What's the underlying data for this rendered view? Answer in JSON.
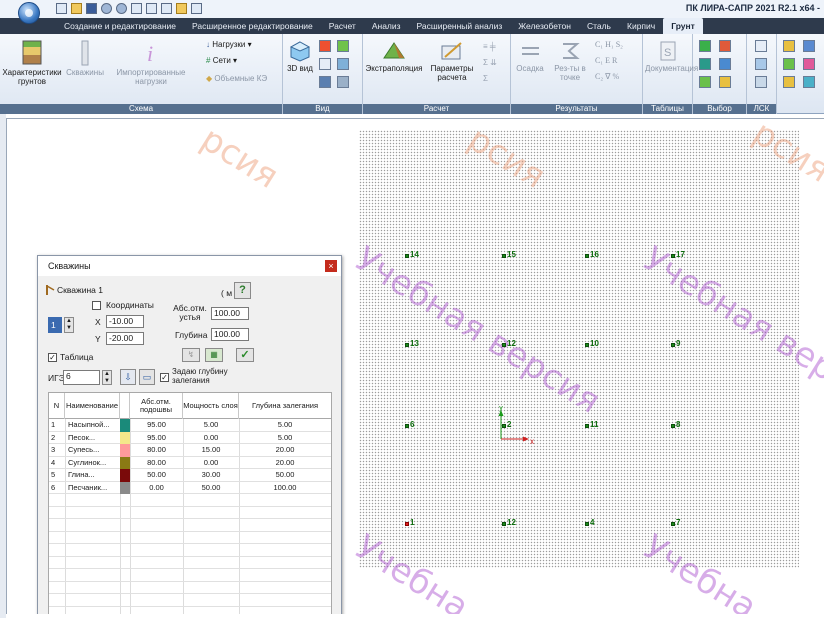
{
  "app": {
    "title": "ПК ЛИРА-САПР  2021 R2.1 x64 - "
  },
  "tabs": [
    {
      "label": "Создание и редактирование",
      "active": false
    },
    {
      "label": "Расширенное редактирование",
      "active": false
    },
    {
      "label": "Расчет",
      "active": false
    },
    {
      "label": "Анализ",
      "active": false
    },
    {
      "label": "Расширенный анализ",
      "active": false
    },
    {
      "label": "Железобетон",
      "active": false
    },
    {
      "label": "Сталь",
      "active": false
    },
    {
      "label": "Кирпич",
      "active": false
    },
    {
      "label": "Грунт",
      "active": true
    }
  ],
  "ribbon": {
    "groups": {
      "schema": "Схема",
      "view": "Вид",
      "calc": "Расчет",
      "results": "Результаты",
      "tables": "Таблицы",
      "selection": "Выбор",
      "lsk": "ЛСК"
    },
    "buttons": {
      "soil_chars": "Характеристики грунтов",
      "boreholes": "Скважины",
      "imported_loads": "Импортированные нагрузки",
      "loads": "Нагрузки",
      "meshes": "Сети",
      "volumetric_ke": "Объемные КЭ",
      "view3d": "3D вид",
      "extrapolation": "Экстраполяция",
      "calc_params": "Параметры расчета",
      "settlement": "Осадка",
      "results_at_point": "Рез-ты в точке",
      "documentation": "Документация"
    },
    "result_symbols": [
      "C₁",
      "H₁",
      "S₂",
      "C₁",
      "E",
      "R",
      "C₂",
      "∇",
      "%"
    ]
  },
  "dialog": {
    "title": "Скважины",
    "borehole_name": "Скважина 1",
    "units": "( м )",
    "help": "?",
    "borehole_number": "1",
    "coords_label": "Координаты",
    "x_label": "X",
    "x_value": "-10.00",
    "y_label": "Y",
    "y_value": "-20.00",
    "abs_mark_label": "Абс.отм. устья",
    "abs_mark_value": "100.00",
    "depth_label": "Глубина",
    "depth_value": "100.00",
    "table_checkbox": "Таблица",
    "table_checked": true,
    "ige_label": "ИГЭ",
    "ige_value": "6",
    "set_depth_label": "Задаю глубину залегания",
    "set_depth_checked": true,
    "columns": [
      "N",
      "Наименование",
      "",
      "Абс.отм. подошвы",
      "Мощность слоя",
      "Глубина залегания"
    ],
    "layers": [
      {
        "n": "1",
        "name": "Насыпной...",
        "color": "#1a8a7a",
        "abs": "95.00",
        "thickness": "5.00",
        "depth": "5.00"
      },
      {
        "n": "2",
        "name": "Песок...",
        "color": "#f4e88a",
        "abs": "95.00",
        "thickness": "0.00",
        "depth": "5.00"
      },
      {
        "n": "3",
        "name": "Супесь...",
        "color": "#ff9a9a",
        "abs": "80.00",
        "thickness": "15.00",
        "depth": "20.00"
      },
      {
        "n": "4",
        "name": "Суглинок...",
        "color": "#8a7a14",
        "abs": "80.00",
        "thickness": "0.00",
        "depth": "20.00"
      },
      {
        "n": "5",
        "name": "Глина...",
        "color": "#7a0a0a",
        "abs": "50.00",
        "thickness": "30.00",
        "depth": "50.00"
      },
      {
        "n": "6",
        "name": "Песчаник...",
        "color": "#8a8a8a",
        "abs": "0.00",
        "thickness": "50.00",
        "depth": "100.00"
      }
    ]
  },
  "canvas": {
    "watermark_main": "Учебная версия",
    "watermark_short": "Учебна",
    "watermark_peach": "рсия",
    "axis_x": "x",
    "axis_y": "y",
    "boreholes": [
      {
        "label": "14",
        "active": false
      },
      {
        "label": "15",
        "active": false
      },
      {
        "label": "16",
        "active": false
      },
      {
        "label": "17",
        "active": false
      },
      {
        "label": "13",
        "active": false
      },
      {
        "label": "12",
        "active": false
      },
      {
        "label": "10",
        "active": false
      },
      {
        "label": "9",
        "active": false
      },
      {
        "label": "6",
        "active": false
      },
      {
        "label": "2",
        "active": false
      },
      {
        "label": "11",
        "active": false
      },
      {
        "label": "8",
        "active": false
      },
      {
        "label": "1",
        "active": true
      },
      {
        "label": "12",
        "active": false
      },
      {
        "label": "4",
        "active": false
      },
      {
        "label": "7",
        "active": false
      }
    ]
  }
}
